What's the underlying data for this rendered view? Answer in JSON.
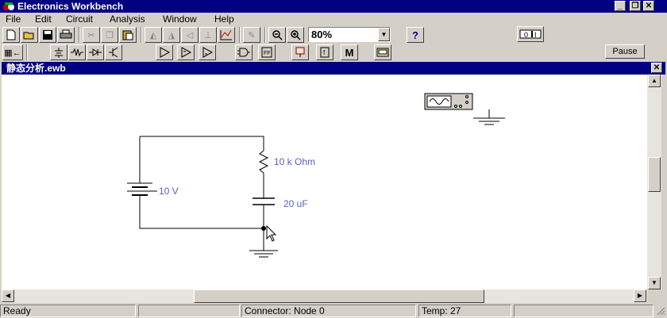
{
  "app": {
    "title": "Electronics Workbench"
  },
  "menu": [
    {
      "label": "File"
    },
    {
      "label": "Edit"
    },
    {
      "label": "Circuit"
    },
    {
      "label": "Analysis"
    },
    {
      "label": "Window"
    },
    {
      "label": "Help"
    }
  ],
  "toolbar": {
    "zoom_value": "80%",
    "pause_label": "Pause",
    "help_label": "?",
    "meter_label": "M"
  },
  "document": {
    "title": "静态分析.ewb"
  },
  "circuit": {
    "battery_label": "10 V",
    "resistor_label": "10 k Ohm",
    "capacitor_label": "20 uF"
  },
  "status": {
    "state": "Ready",
    "connector": "Connector: Node 0",
    "temp": "Temp:  27"
  },
  "colors": {
    "title_bg": "#000080",
    "chrome": "#d4d0c8",
    "label": "#5a5fb8"
  }
}
